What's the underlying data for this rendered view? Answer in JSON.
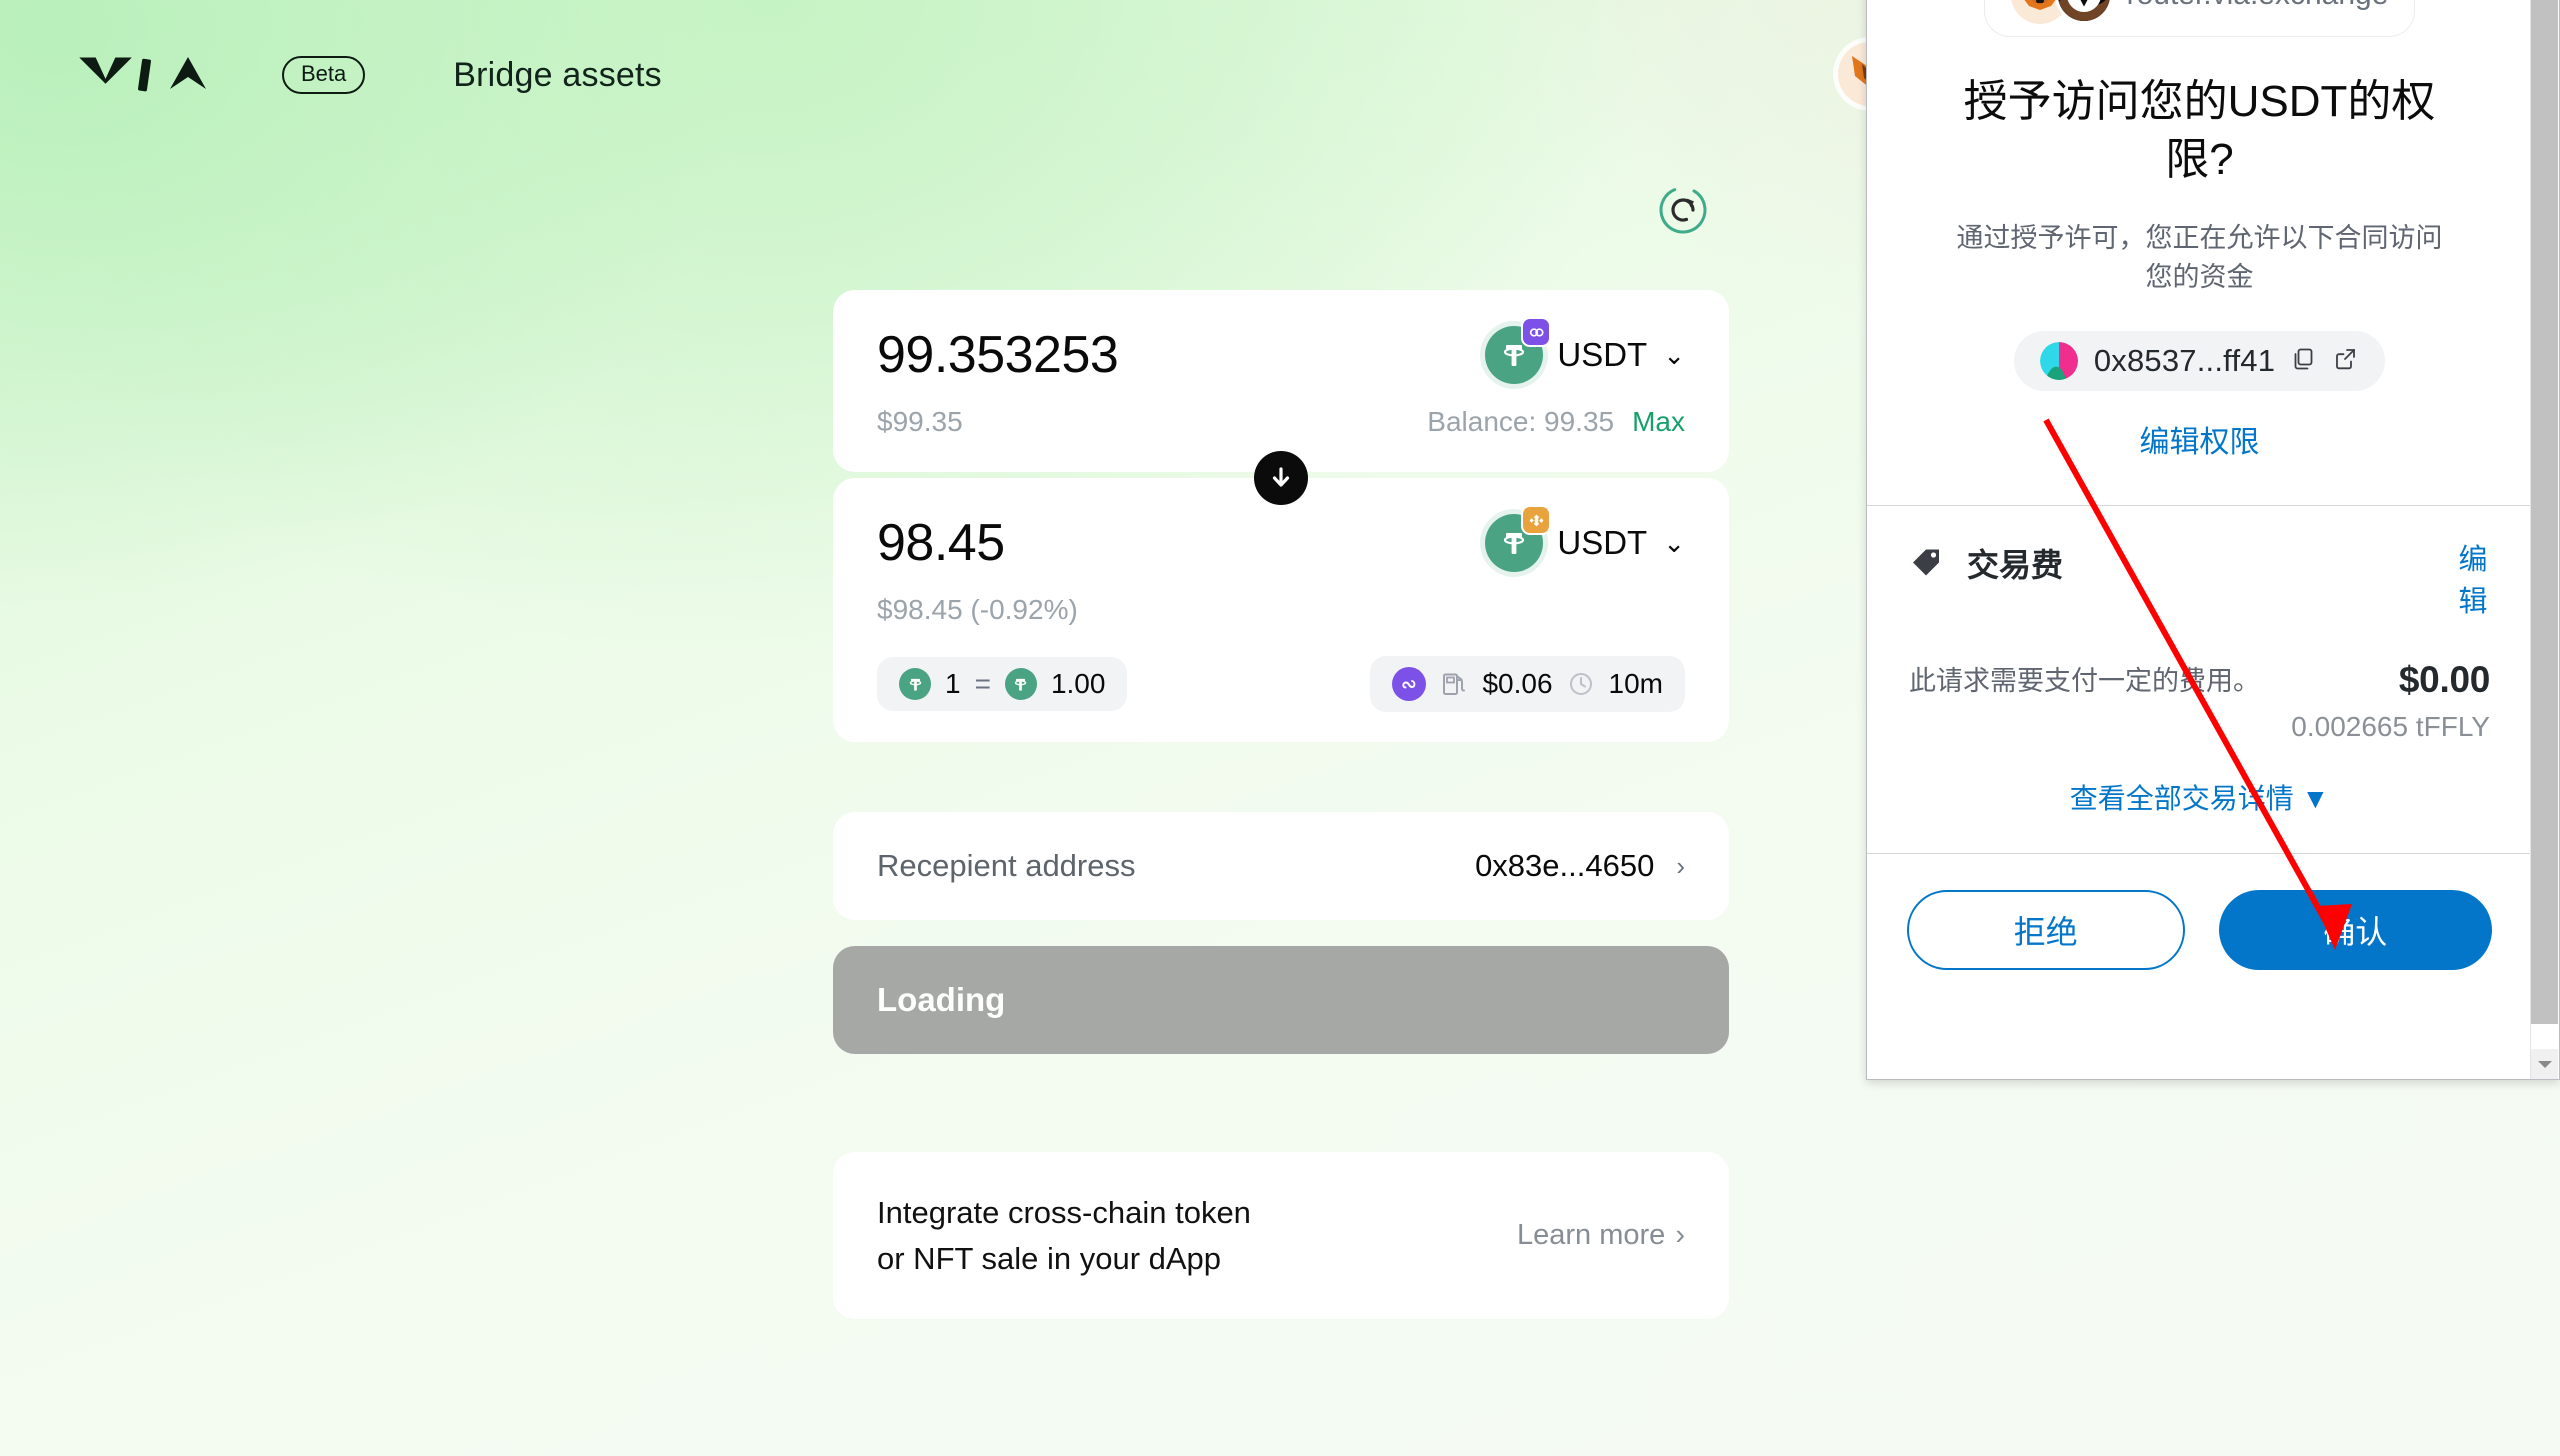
{
  "header": {
    "logo_name": "via-logo",
    "beta_label": "Beta",
    "page_title": "Bridge assets"
  },
  "main": {
    "refresh_icon": "refresh-icon",
    "from": {
      "amount": "99.353253",
      "usd_value": "$99.35",
      "balance_label": "Balance: 99.35",
      "max_label": "Max",
      "token_symbol": "USDT",
      "token_icon": "usdt-icon",
      "chain_badge": "polygon-chain-badge",
      "chevron": "⌄"
    },
    "swap_icon": "swap-arrow-down-icon",
    "to": {
      "amount": "98.45",
      "usd_value": "$98.45 (-0.92%)",
      "token_symbol": "USDT",
      "token_icon": "usdt-icon",
      "chain_badge": "bnb-chain-badge",
      "chevron": "⌄"
    },
    "rate": {
      "left_amount": "1",
      "equals": "=",
      "right_amount": "1.00",
      "left_token_icon": "usdt-icon",
      "right_token_icon": "usdt-icon"
    },
    "route_info": {
      "route_icon": "route-provider-icon",
      "gas_icon": "gas-pump-icon",
      "gas_cost": "$0.06",
      "time_icon": "clock-icon",
      "duration": "10m"
    },
    "recipient": {
      "label": "Recepient address",
      "value": "0x83e...4650",
      "chevron": "›"
    },
    "action_button": {
      "label": "Loading",
      "state": "disabled",
      "color": "#a6a8a5"
    },
    "promo": {
      "line1": "Integrate cross-chain token",
      "line2": "or NFT sale in your dApp",
      "link_label": "Learn more",
      "link_chevron": "›"
    }
  },
  "metamask": {
    "origin_url": "router.via.exchange",
    "title": "授予访问您的USDT的权限?",
    "description": "通过授予许可，您正在允许以下合同访问您的资金",
    "contract_address": "0x8537...ff41",
    "copy_icon": "copy-icon",
    "open_icon": "external-link-icon",
    "edit_permission_label": "编辑权限",
    "fee": {
      "tag_icon": "tag-icon",
      "title": "交易费",
      "edit_label": "编辑",
      "note": "此请求需要支付一定的费用。",
      "amount_fiat": "$0.00",
      "amount_native": "0.002665 tFFLY",
      "details_label": "查看全部交易详情",
      "details_caret": "▼"
    },
    "reject_label": "拒绝",
    "confirm_label": "确认",
    "scrollbar_down_icon": "scroll-down-arrow-icon"
  },
  "annotation": {
    "arrow": "red-pointer-arrow",
    "color": "#ff0000"
  },
  "colors": {
    "accent_green": "#18a06a",
    "mm_blue": "#0376c9",
    "usdt_green": "#4aa484",
    "polygon_purple": "#7b51e8",
    "bnb_gold": "#e8a33c"
  }
}
